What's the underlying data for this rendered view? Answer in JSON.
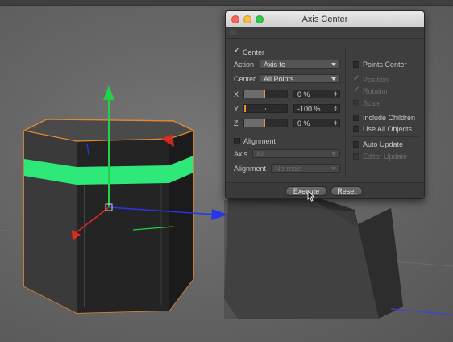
{
  "dialog": {
    "title": "Axis Center",
    "center_label": "Center",
    "center_checked": true,
    "action": {
      "label": "Action",
      "value": "Axis to"
    },
    "center_field": {
      "label": "Center",
      "value": "All Points"
    },
    "axes": [
      {
        "label": "X",
        "value": "0 %",
        "percent": 0
      },
      {
        "label": "Y",
        "value": "-100 %",
        "percent": -100
      },
      {
        "label": "Z",
        "value": "0 %",
        "percent": 0
      }
    ],
    "alignment": {
      "label": "Alignment",
      "checked": false
    },
    "axis_select": {
      "label": "Axis",
      "value": "All"
    },
    "alignment_select": {
      "label": "Alignment",
      "value": "Normals"
    },
    "right_options": [
      {
        "label": "Points Center",
        "checked": false,
        "enabled": true
      },
      {
        "label": "Position",
        "checked": true,
        "enabled": false
      },
      {
        "label": "Rotation",
        "checked": true,
        "enabled": false
      },
      {
        "label": "Scale",
        "checked": false,
        "enabled": false
      },
      {
        "label": "Include Children",
        "checked": false,
        "enabled": true
      },
      {
        "label": "Use All Objects",
        "checked": false,
        "enabled": true
      },
      {
        "label": "Auto Update",
        "checked": false,
        "enabled": true
      },
      {
        "label": "Editor Update",
        "checked": false,
        "enabled": false
      }
    ],
    "execute_label": "Execute",
    "reset_label": "Reset"
  },
  "colors": {
    "dialog_bg": "#3e3e3e",
    "slider_knob": "#e29a2b",
    "axis_x": "#e02a20",
    "axis_y": "#22d04a",
    "axis_z": "#2a35e8",
    "selection_band": "#2fe87a",
    "selection_outline": "#e08a30"
  }
}
